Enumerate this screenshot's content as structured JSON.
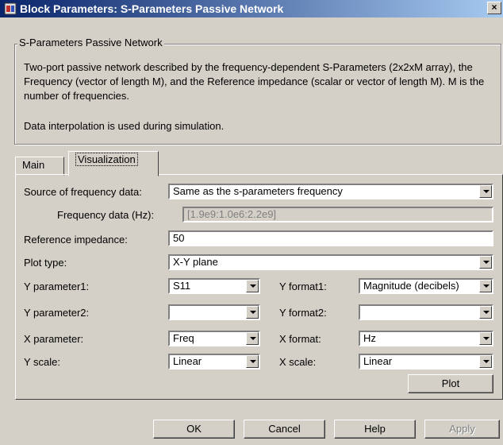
{
  "window": {
    "title": "Block Parameters: S-Parameters Passive Network",
    "close_label": "×"
  },
  "group": {
    "title": "S-Parameters Passive Network",
    "description": "Two-port passive network described by the frequency-dependent S-Parameters (2x2xM array),  the Frequency (vector of length M), and the Reference impedance (scalar or vector of length M).  M is the number of frequencies.",
    "interpolation_note": "Data interpolation is used during simulation."
  },
  "tabs": [
    "Main",
    "Visualization"
  ],
  "fields": {
    "source_label": "Source of frequency data:",
    "source_value": "Same as the s-parameters frequency",
    "freq_label": "Frequency data (Hz):",
    "freq_value": "[1.9e9:1.0e6:2.2e9]",
    "refimp_label": "Reference impedance:",
    "refimp_value": "50",
    "plottype_label": "Plot type:",
    "plottype_value": "X-Y plane",
    "yparam1_label": "Y parameter1:",
    "yparam1_value": "S11",
    "yformat1_label": "Y format1:",
    "yformat1_value": "Magnitude (decibels)",
    "yparam2_label": "Y parameter2:",
    "yparam2_value": "",
    "yformat2_label": "Y format2:",
    "yformat2_value": "",
    "xparam_label": "X parameter:",
    "xparam_value": "Freq",
    "xformat_label": "X format:",
    "xformat_value": "Hz",
    "yscale_label": "Y scale:",
    "yscale_value": "Linear",
    "xscale_label": "X scale:",
    "xscale_value": "Linear"
  },
  "buttons": {
    "plot": "Plot",
    "ok": "OK",
    "cancel": "Cancel",
    "help": "Help",
    "apply": "Apply"
  }
}
